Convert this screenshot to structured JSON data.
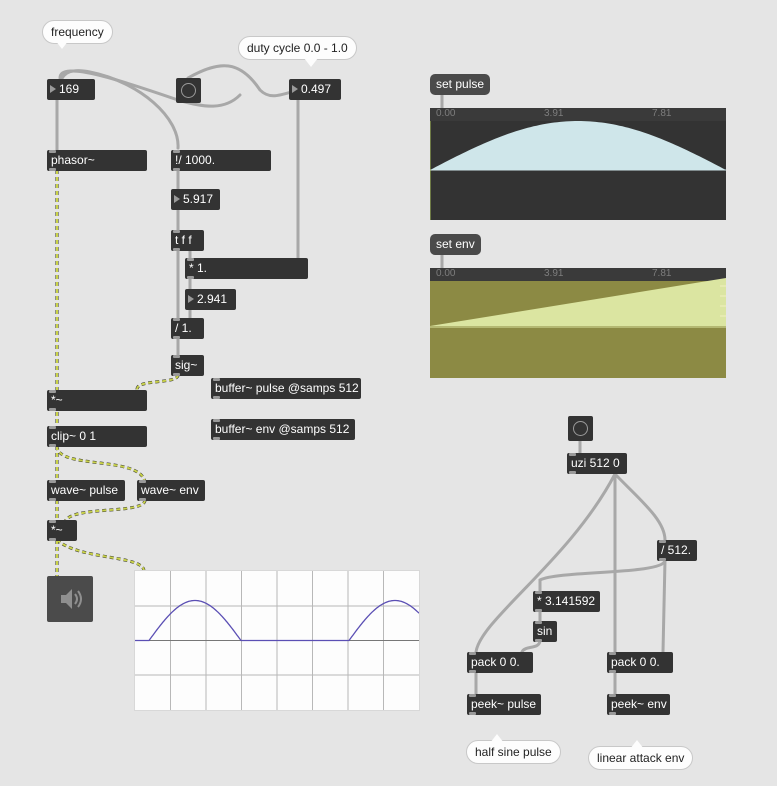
{
  "comments": {
    "frequency": "frequency",
    "duty_cycle": "duty cycle 0.0 - 1.0",
    "half_sine": "half sine pulse",
    "linear_attack": "linear attack env"
  },
  "numbers": {
    "frequency": "169",
    "duty": "0.497",
    "period_ms": "5.917",
    "pulse_ms": "2.941"
  },
  "objects": {
    "phasor": "phasor~",
    "rdiv": "!/ 1000.",
    "tff": "t f f",
    "mul1": "* 1.",
    "div1": "/ 1.",
    "sig": "sig~",
    "mulsig": "*~",
    "clip": "clip~ 0 1",
    "wave_pulse": "wave~ pulse",
    "wave_env": "wave~ env",
    "mulsig2": "*~",
    "buf_pulse": "buffer~ pulse @samps 512",
    "buf_env": "buffer~ env @samps 512",
    "uzi": "uzi 512 0",
    "div512": "/ 512.",
    "mulpi": "* 3.141592",
    "sin": "sin",
    "pack1": "pack 0 0.",
    "pack2": "pack 0 0.",
    "peek_pulse": "peek~ pulse",
    "peek_env": "peek~ env"
  },
  "messages": {
    "set_pulse": "set pulse",
    "set_env": "set env"
  },
  "waveform_pulse": {
    "ticks": [
      "0.00",
      "3.91",
      "7.81"
    ],
    "fill_color": "#cfe6ea",
    "curve": "half-sine"
  },
  "waveform_env": {
    "ticks": [
      "0.00",
      "3.91",
      "7.81"
    ],
    "bg_color": "#8c8a44",
    "fill_color": "#dbe5a1",
    "curve": "linear-ramp"
  },
  "icons": {
    "dac": "speaker-icon"
  },
  "colors": {
    "signal_patchcord": "#c9d24a",
    "control_patchcord": "#a8a8a8",
    "scope_line": "#5b4fb4"
  }
}
